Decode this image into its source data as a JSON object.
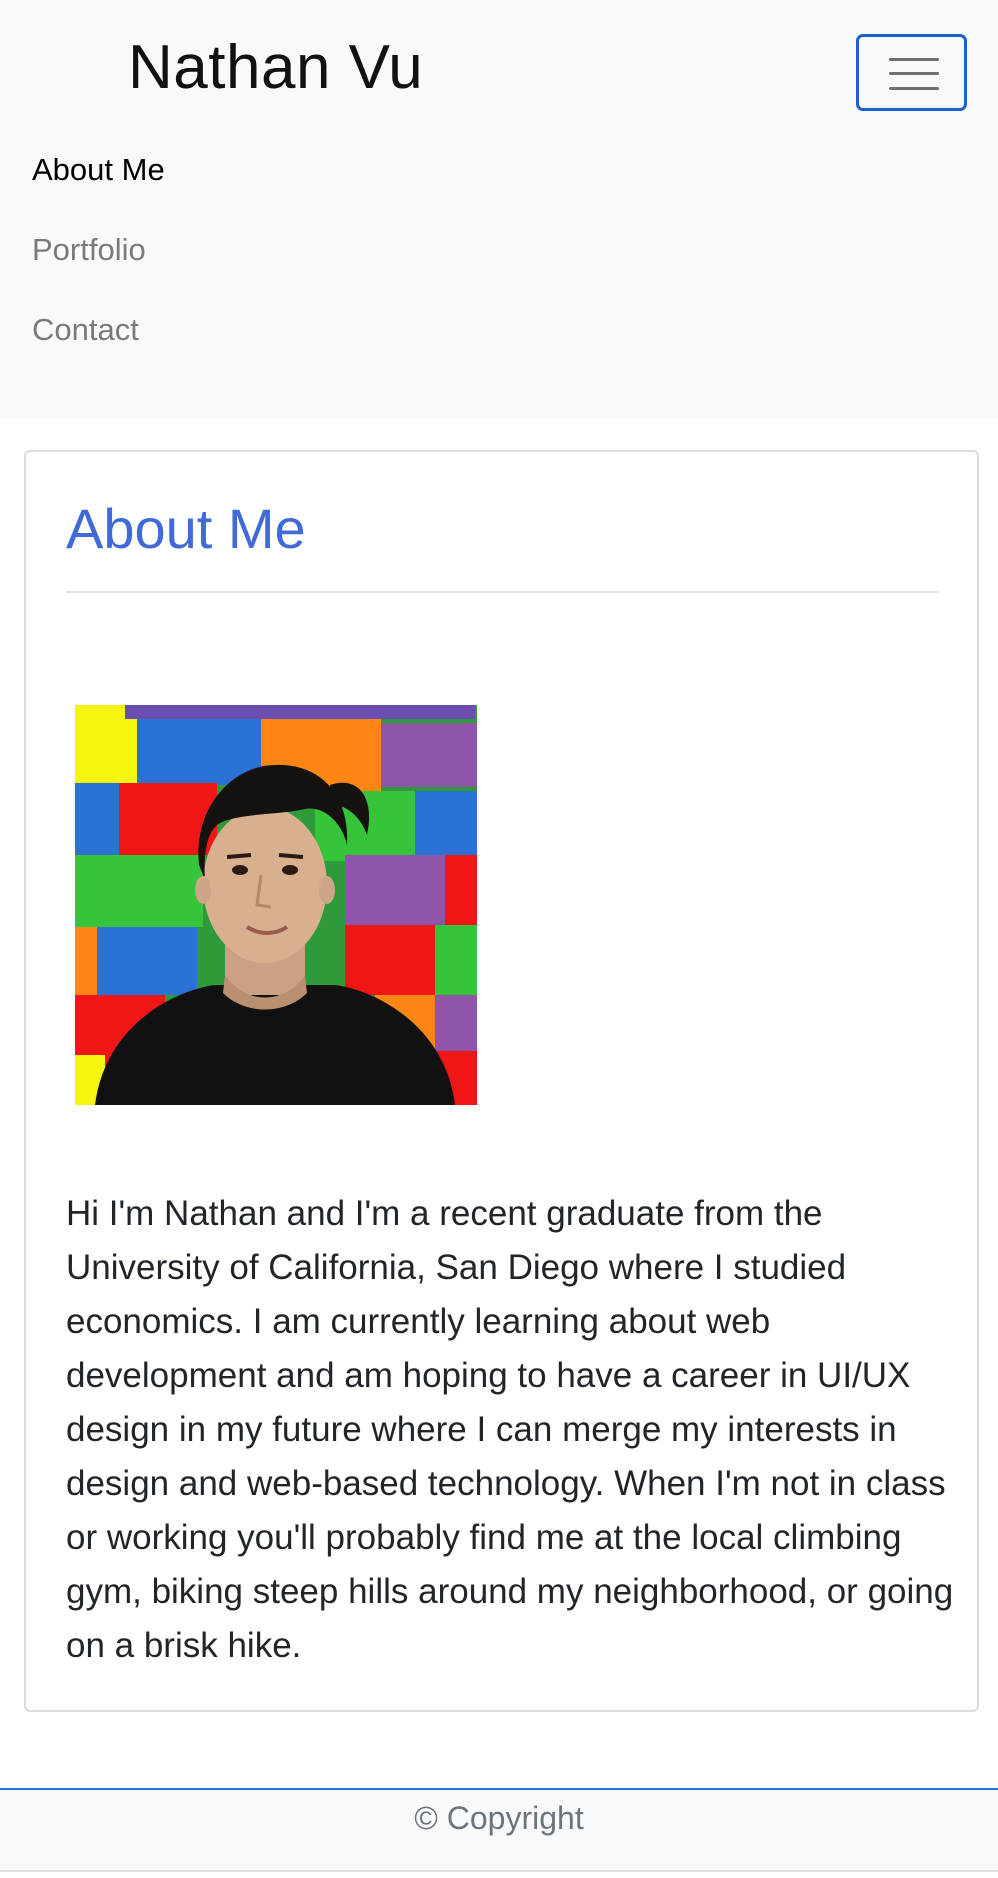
{
  "header": {
    "brand": "Nathan Vu",
    "menu_toggle_icon": "hamburger-icon"
  },
  "nav": {
    "items": [
      {
        "label": "About Me",
        "active": true
      },
      {
        "label": "Portfolio",
        "active": false
      },
      {
        "label": "Contact",
        "active": false
      }
    ]
  },
  "about": {
    "title": "About Me",
    "photo_alt": "Portrait of Nathan Vu in front of a colorful brick wall",
    "bio": "Hi I'm Nathan and I'm a recent graduate from the University of California, San Diego where I studied economics. I am currently learning about web development and am hoping to have a career in UI/UX design in my future where I can merge my interests in design and web-based technology. When I'm not in class or working you'll probably find me at the local climbing gym, biking steep hills around my neighborhood, or going on a brisk hike."
  },
  "footer": {
    "copyright": "© Copyright"
  },
  "colors": {
    "accent": "#3f6ad8",
    "navbar_bg": "#f8f9fa",
    "toggler_border": "#1e5fc9",
    "footer_border": "#2a6fd6"
  }
}
